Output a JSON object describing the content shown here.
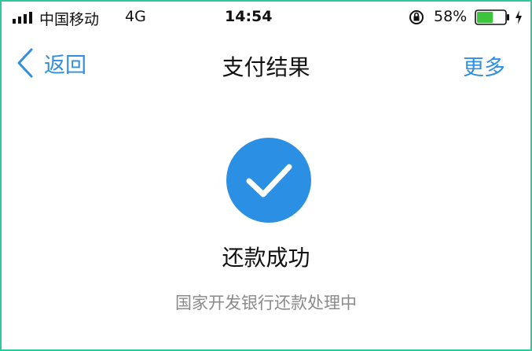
{
  "status_bar": {
    "carrier": "中国移动",
    "network": "4G",
    "time": "14:54",
    "battery_percent": "58%",
    "battery_level": 0.58,
    "battery_color": "#3cc43c",
    "icons": [
      "signal-icon",
      "orientation-lock-icon",
      "battery-icon",
      "charging-icon"
    ]
  },
  "nav": {
    "back_label": "返回",
    "title": "支付结果",
    "more_label": "更多",
    "accent_color": "#2f8fe0"
  },
  "result": {
    "icon": "checkmark-icon",
    "icon_color": "#2b8fe3",
    "title": "还款成功",
    "subtitle": "国家开发银行还款处理中"
  }
}
